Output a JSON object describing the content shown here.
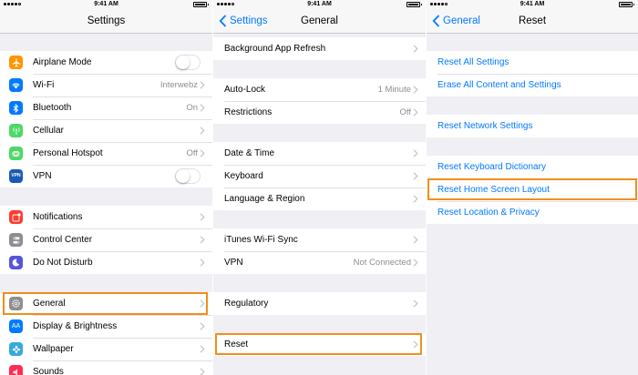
{
  "status_time": "9:41 AM",
  "colors": {
    "accent": "#007aff",
    "highlight": "#f18f1c",
    "background": "#efeff4"
  },
  "settings_screen": {
    "title": "Settings",
    "groups": [
      [
        {
          "label": "Airplane Mode",
          "icon": "airplane-icon",
          "icon_color": "#ff9500",
          "toggle": "off"
        },
        {
          "label": "Wi-Fi",
          "icon": "wifi-icon",
          "icon_color": "#007aff",
          "value": "Interwebz"
        },
        {
          "label": "Bluetooth",
          "icon": "bluetooth-icon",
          "icon_color": "#007aff",
          "value": "On"
        },
        {
          "label": "Cellular",
          "icon": "cellular-icon",
          "icon_color": "#4cd964"
        },
        {
          "label": "Personal Hotspot",
          "icon": "hotspot-icon",
          "icon_color": "#4cd964",
          "value": "Off"
        },
        {
          "label": "VPN",
          "icon": "vpn-icon",
          "icon_color": "#1a5bb5",
          "icon_text": "VPN",
          "toggle": "off"
        }
      ],
      [
        {
          "label": "Notifications",
          "icon": "notifications-icon",
          "icon_color": "#ff3b30"
        },
        {
          "label": "Control Center",
          "icon": "control-center-icon",
          "icon_color": "#8e8e93"
        },
        {
          "label": "Do Not Disturb",
          "icon": "moon-icon",
          "icon_color": "#5856d6"
        }
      ],
      [
        {
          "label": "General",
          "icon": "gear-icon",
          "icon_color": "#8e8e93",
          "highlighted": true
        },
        {
          "label": "Display & Brightness",
          "icon": "display-brightness-icon",
          "icon_color": "#007aff",
          "icon_text": "AA"
        },
        {
          "label": "Wallpaper",
          "icon": "wallpaper-icon",
          "icon_color": "#35aadc"
        },
        {
          "label": "Sounds",
          "icon": "sounds-icon",
          "icon_color": "#ff2d55"
        }
      ]
    ]
  },
  "general_screen": {
    "title": "General",
    "back_label": "Settings",
    "groups": [
      [
        {
          "label": "Background App Refresh"
        }
      ],
      [
        {
          "label": "Auto-Lock",
          "value": "1 Minute"
        },
        {
          "label": "Restrictions",
          "value": "Off"
        }
      ],
      [
        {
          "label": "Date & Time"
        },
        {
          "label": "Keyboard"
        },
        {
          "label": "Language & Region"
        }
      ],
      [
        {
          "label": "iTunes Wi-Fi Sync"
        },
        {
          "label": "VPN",
          "value": "Not Connected"
        }
      ],
      [
        {
          "label": "Regulatory"
        }
      ],
      [
        {
          "label": "Reset",
          "highlighted": true
        }
      ]
    ]
  },
  "reset_screen": {
    "title": "Reset",
    "back_label": "General",
    "groups": [
      [
        {
          "label": "Reset All Settings"
        },
        {
          "label": "Erase All Content and Settings"
        }
      ],
      [
        {
          "label": "Reset Network Settings"
        }
      ],
      [
        {
          "label": "Reset Keyboard Dictionary"
        },
        {
          "label": "Reset Home Screen Layout",
          "highlighted": true
        },
        {
          "label": "Reset Location & Privacy"
        }
      ]
    ]
  }
}
